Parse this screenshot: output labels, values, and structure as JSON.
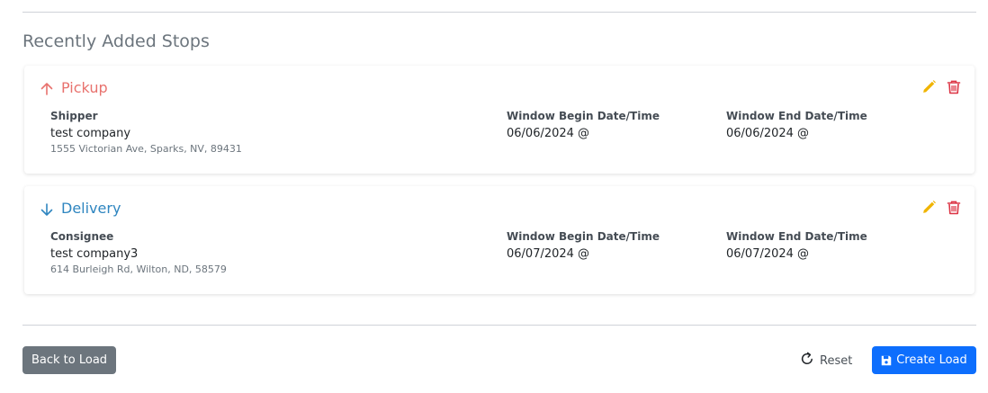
{
  "section_title": "Recently Added Stops",
  "colors": {
    "pickup": "#e8726e",
    "delivery": "#2f86c0",
    "edit": "#f0b400",
    "delete": "#dc3545",
    "primary": "#0d6efd",
    "secondary": "#6c757d"
  },
  "stops": [
    {
      "type_label": "Pickup",
      "direction_icon": "arrow-up-icon",
      "party_label": "Shipper",
      "party_name": "test company",
      "party_address": "1555 Victorian Ave, Sparks, NV, 89431",
      "begin_label": "Window Begin Date/Time",
      "begin_value": "06/06/2024 @",
      "end_label": "Window End Date/Time",
      "end_value": "06/06/2024 @"
    },
    {
      "type_label": "Delivery",
      "direction_icon": "arrow-down-icon",
      "party_label": "Consignee",
      "party_name": "test company3",
      "party_address": "614 Burleigh Rd, Wilton, ND, 58579",
      "begin_label": "Window Begin Date/Time",
      "begin_value": "06/07/2024 @",
      "end_label": "Window End Date/Time",
      "end_value": "06/07/2024 @"
    }
  ],
  "footer": {
    "back_label": "Back to Load",
    "reset_label": "Reset",
    "create_label": "Create Load"
  }
}
